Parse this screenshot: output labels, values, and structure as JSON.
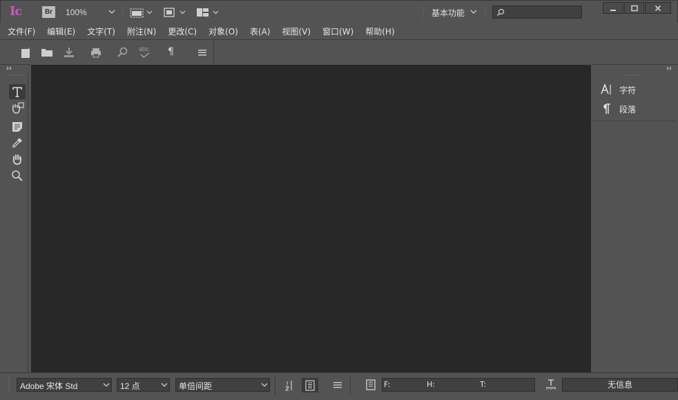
{
  "app": {
    "logo": "Ic",
    "bridge_badge": "Br",
    "zoom": "100%",
    "workspace": "基本功能",
    "search_placeholder": ""
  },
  "menu": {
    "items": [
      "文件(F)",
      "编辑(E)",
      "文字(T)",
      "附注(N)",
      "更改(C)",
      "对象(O)",
      "表(A)",
      "视图(V)",
      "窗口(W)",
      "帮助(H)"
    ]
  },
  "toolbar": {
    "icons": [
      "new-doc-icon",
      "open-folder-icon",
      "download-icon",
      "print-icon",
      "find-icon",
      "spellcheck-icon",
      "pilcrow-icon",
      "menu-icon"
    ],
    "spellcheck_label": "abc",
    "pilcrow": "¶"
  },
  "tools": {
    "items": [
      "type-tool-icon",
      "position-tool-icon",
      "note-tool-icon",
      "eyedropper-tool-icon",
      "hand-tool-icon",
      "zoom-tool-icon"
    ]
  },
  "panels": {
    "items": [
      {
        "icon": "character-icon",
        "label": "字符"
      },
      {
        "icon": "paragraph-icon",
        "label": "段落"
      }
    ]
  },
  "status": {
    "font": "Adobe 宋体 Std",
    "size": "12 点",
    "spacing": "单倍间距",
    "metric_f": "F:",
    "metric_h": "H:",
    "metric_t": "T:",
    "info": "无信息"
  }
}
